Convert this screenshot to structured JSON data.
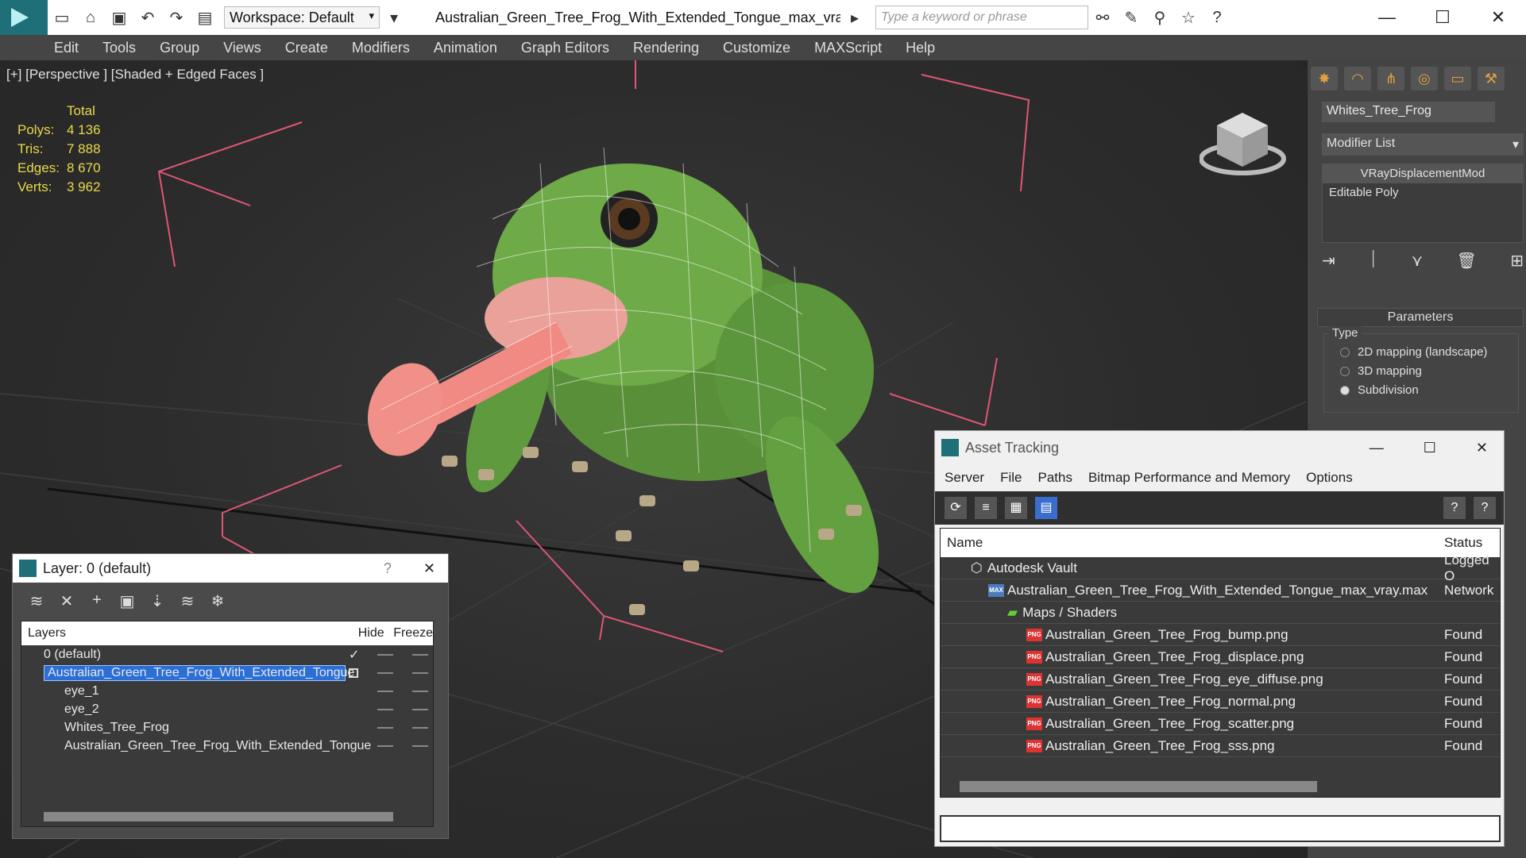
{
  "titlebar": {
    "workspace": "Workspace: Default",
    "document_title": "Australian_Green_Tree_Frog_With_Extended_Tongue_max_vra...",
    "search_placeholder": "Type a keyword or phrase"
  },
  "menu": [
    "Edit",
    "Tools",
    "Group",
    "Views",
    "Create",
    "Modifiers",
    "Animation",
    "Graph Editors",
    "Rendering",
    "Customize",
    "MAXScript",
    "Help"
  ],
  "viewport": {
    "label": "[+] [Perspective ] [Shaded + Edged Faces ]",
    "stats": {
      "header": "Total",
      "rows": [
        {
          "label": "Polys:",
          "value": "4 136"
        },
        {
          "label": "Tris:",
          "value": "7 888"
        },
        {
          "label": "Edges:",
          "value": "8 670"
        },
        {
          "label": "Verts:",
          "value": "3 962"
        }
      ]
    }
  },
  "command_panel": {
    "object_name": "Whites_Tree_Frog",
    "modifier_list": "Modifier List",
    "stack": [
      "VRayDisplacementMod",
      "Editable Poly"
    ],
    "parameters_title": "Parameters",
    "type_legend": "Type",
    "type_options": [
      {
        "label": "2D mapping (landscape)",
        "selected": false
      },
      {
        "label": "3D mapping",
        "selected": false
      },
      {
        "label": "Subdivision",
        "selected": true
      }
    ]
  },
  "layer_dialog": {
    "title": "Layer: 0 (default)",
    "help": "?",
    "columns": {
      "layers": "Layers",
      "hide": "Hide",
      "freeze": "Freeze"
    },
    "rows": [
      {
        "name": "0 (default)",
        "selected": false
      },
      {
        "name": "Australian_Green_Tree_Frog_With_Extended_Tongue",
        "selected": true
      },
      {
        "name": "eye_1",
        "selected": false
      },
      {
        "name": "eye_2",
        "selected": false
      },
      {
        "name": "Whites_Tree_Frog",
        "selected": false
      },
      {
        "name": "Australian_Green_Tree_Frog_With_Extended_Tongue",
        "selected": false
      }
    ]
  },
  "asset_dialog": {
    "title": "Asset Tracking",
    "menu": [
      "Server",
      "File",
      "Paths",
      "Bitmap Performance and Memory",
      "Options"
    ],
    "columns": {
      "name": "Name",
      "status": "Status"
    },
    "rows": [
      {
        "name": "Autodesk Vault",
        "status": "Logged O"
      },
      {
        "name": "Australian_Green_Tree_Frog_With_Extended_Tongue_max_vray.max",
        "status": "Network"
      },
      {
        "name": "Maps / Shaders",
        "status": ""
      },
      {
        "name": "Australian_Green_Tree_Frog_bump.png",
        "status": "Found"
      },
      {
        "name": "Australian_Green_Tree_Frog_displace.png",
        "status": "Found"
      },
      {
        "name": "Australian_Green_Tree_Frog_eye_diffuse.png",
        "status": "Found"
      },
      {
        "name": "Australian_Green_Tree_Frog_normal.png",
        "status": "Found"
      },
      {
        "name": "Australian_Green_Tree_Frog_scatter.png",
        "status": "Found"
      },
      {
        "name": "Australian_Green_Tree_Frog_sss.png",
        "status": "Found"
      }
    ]
  }
}
